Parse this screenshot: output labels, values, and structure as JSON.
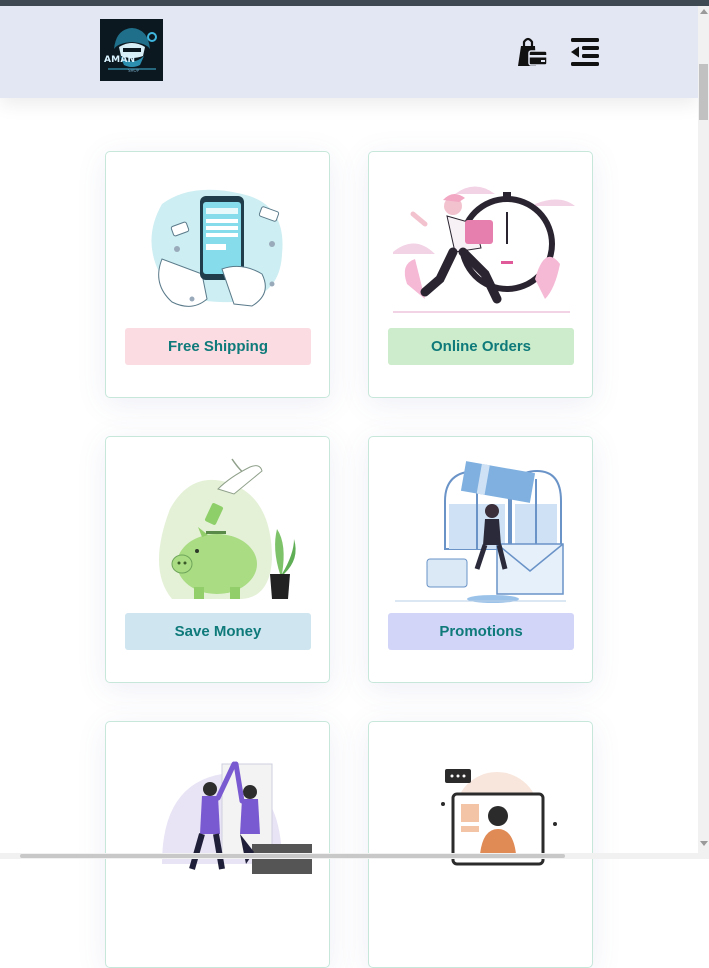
{
  "header": {
    "logo_text": "AMAN",
    "logo_sub": "SHOP",
    "bag_icon": "shopping-bag-icon",
    "menu_icon": "menu-indent-icon"
  },
  "colors": {
    "header_bg": "#e3e6f3",
    "label_text": "#0f7a7a",
    "free_shipping_bg": "#fadce2",
    "online_orders_bg": "#cdeccb",
    "save_money_bg": "#cfe5f0",
    "promotions_bg": "#d2d5f8",
    "card_border": "#c7e7da"
  },
  "features": [
    {
      "label": "Free Shipping",
      "illustration": "mobile-payment-illustration"
    },
    {
      "label": "Online Orders",
      "illustration": "delivery-clock-illustration"
    },
    {
      "label": "Save Money",
      "illustration": "piggy-bank-illustration"
    },
    {
      "label": "Promotions",
      "illustration": "gift-voucher-illustration"
    },
    {
      "label": "",
      "illustration": "high-five-team-illustration"
    },
    {
      "label": "",
      "illustration": "online-support-illustration"
    }
  ]
}
